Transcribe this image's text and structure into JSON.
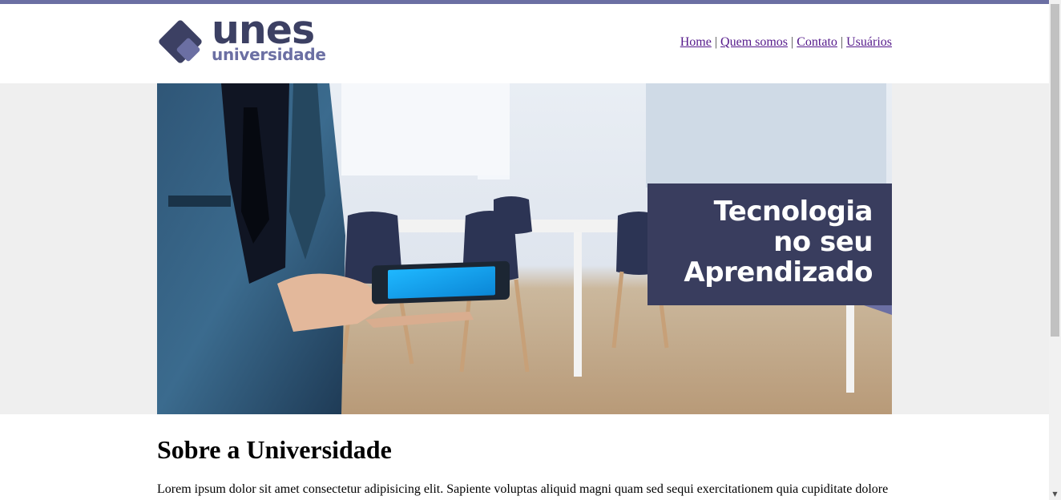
{
  "logo": {
    "word": "unes",
    "sub": "universidade"
  },
  "nav": {
    "items": [
      "Home",
      "Quem somos",
      "Contato",
      "Usuários"
    ],
    "separator": "|"
  },
  "banner": {
    "caption_line1": "Tecnologia",
    "caption_line2": "no seu",
    "caption_line3": "Aprendizado"
  },
  "content": {
    "heading": "Sobre a Universidade",
    "paragraph": "Lorem ipsum dolor sit amet consectetur adipisicing elit. Sapiente voluptas aliquid magni quam sed sequi exercitationem quia cupiditate dolore"
  },
  "colors": {
    "brand_dark": "#3c4063",
    "brand_light": "#6b6fa3",
    "caption_bg": "#393d5e",
    "link": "#551a8b"
  }
}
